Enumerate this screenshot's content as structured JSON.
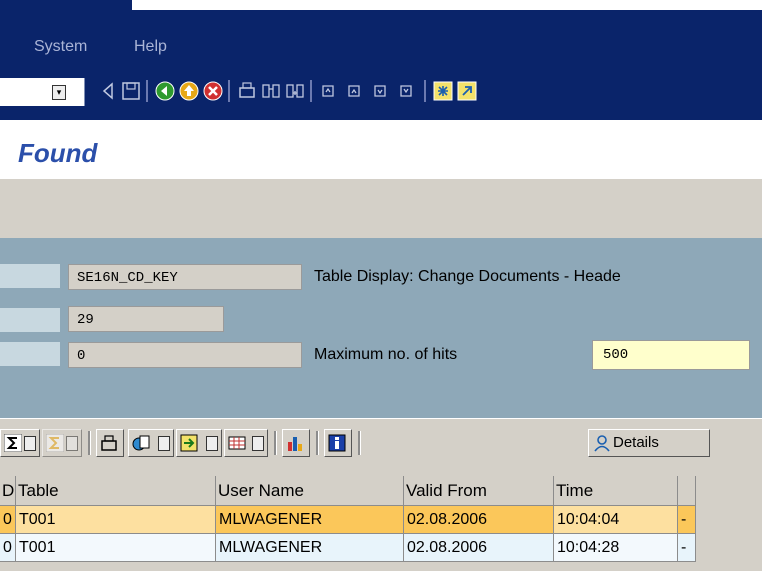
{
  "menu": {
    "items": [
      {
        "label": "System",
        "underline": "S"
      },
      {
        "label": "Help",
        "underline": "H"
      }
    ]
  },
  "toolbar": {
    "icons": [
      "back-icon",
      "save-icon",
      "green-back-icon",
      "exit-icon",
      "cancel-icon",
      "print-icon",
      "find-icon",
      "find-next-icon",
      "first-page-icon",
      "previous-page-icon",
      "next-page-icon",
      "last-page-icon",
      "create-session-icon",
      "shortcut-icon"
    ]
  },
  "title": "Found",
  "header": {
    "table_name": "SE16N_CD_KEY",
    "table_desc": "Table Display: Change Documents - Heade",
    "count": "29",
    "zero": "0",
    "max_hits_label": "Maximum no. of hits",
    "max_hits_value": "500"
  },
  "alv": {
    "details_label": "Details"
  },
  "table": {
    "columns": [
      "D",
      "Table",
      "User Name",
      "Valid From",
      "Time",
      ""
    ],
    "rows": [
      [
        "0",
        "T001",
        "MLWAGENER",
        "02.08.2006",
        "10:04:04",
        "-"
      ],
      [
        "0",
        "T001",
        "MLWAGENER",
        "02.08.2006",
        "10:04:28",
        "-"
      ]
    ]
  },
  "colors": {
    "title": "#2b4faa",
    "banner": "#0a246a",
    "panel": "#8ea8b8",
    "selected_row": "#fbc75a",
    "row": "#e8f4fb"
  }
}
